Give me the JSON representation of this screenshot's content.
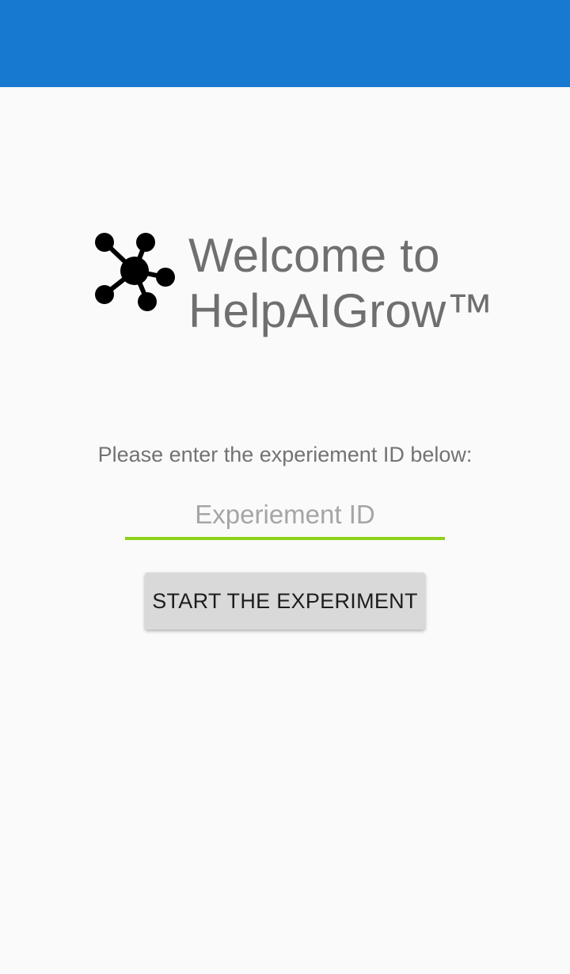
{
  "app_bar": {
    "color": "#1779d0"
  },
  "welcome": {
    "logo_icon": "network-nodes-icon",
    "line1": "Welcome to",
    "line2": "HelpAIGrow™"
  },
  "form": {
    "prompt": "Please enter the experiement ID below:",
    "id_input": {
      "value": "",
      "placeholder": "Experiement ID",
      "underline_color": "#8fd21a"
    },
    "start_button_label": "START THE EXPERIMENT"
  }
}
